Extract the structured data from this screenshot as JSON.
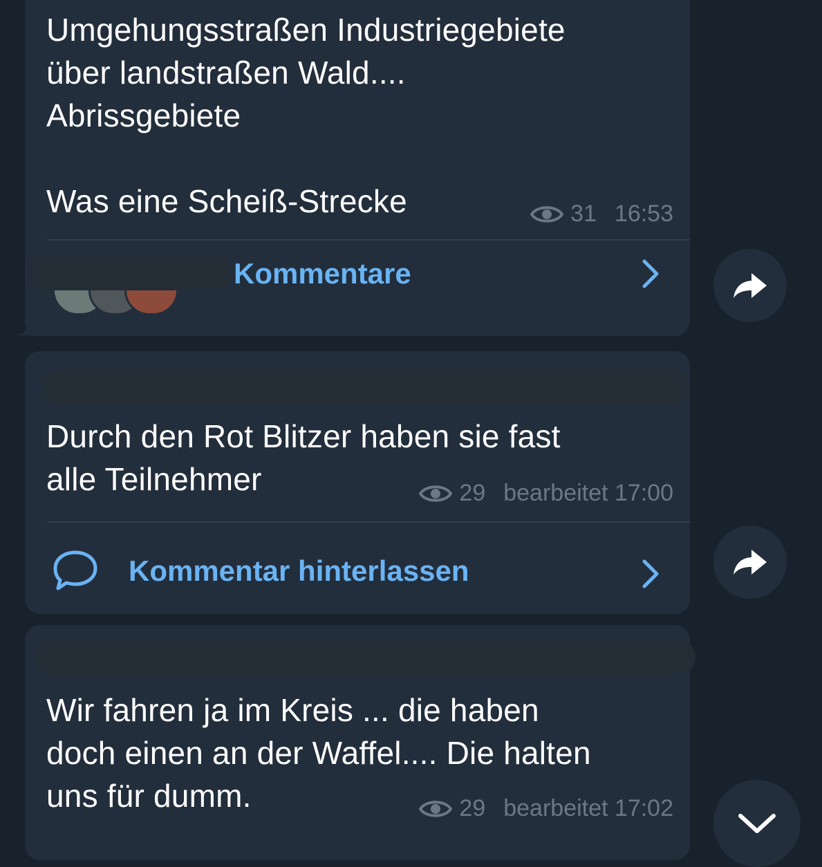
{
  "messages": [
    {
      "text": "Umgehungsstraßen Industriegebiete\nüber landstraßen Wald....\nAbrissgebiete\n\nWas eine Scheiß-Strecke",
      "views": "31",
      "time": "16:53",
      "comment_label": "Kommentare"
    },
    {
      "text": "Durch den Rot Blitzer haben sie fast\nalle Teilnehmer",
      "views": "29",
      "time": "bearbeitet 17:00",
      "comment_label": "Kommentar hinterlassen"
    },
    {
      "text": "Wir fahren ja im Kreis ... die haben\ndoch einen an der Waffel.... Die halten\nuns für dumm.",
      "views": "29",
      "time": "bearbeitet 17:02"
    }
  ],
  "icons": {
    "views": "eye-icon",
    "forward": "forward-arrow-icon",
    "chevron": "chevron-right-icon",
    "comment": "speech-bubble-icon",
    "scroll_down": "chevron-down-icon"
  },
  "colors": {
    "background": "#18222d",
    "bubble": "#232e3c",
    "accent": "#6ab3f3",
    "meta": "#6c7883"
  }
}
